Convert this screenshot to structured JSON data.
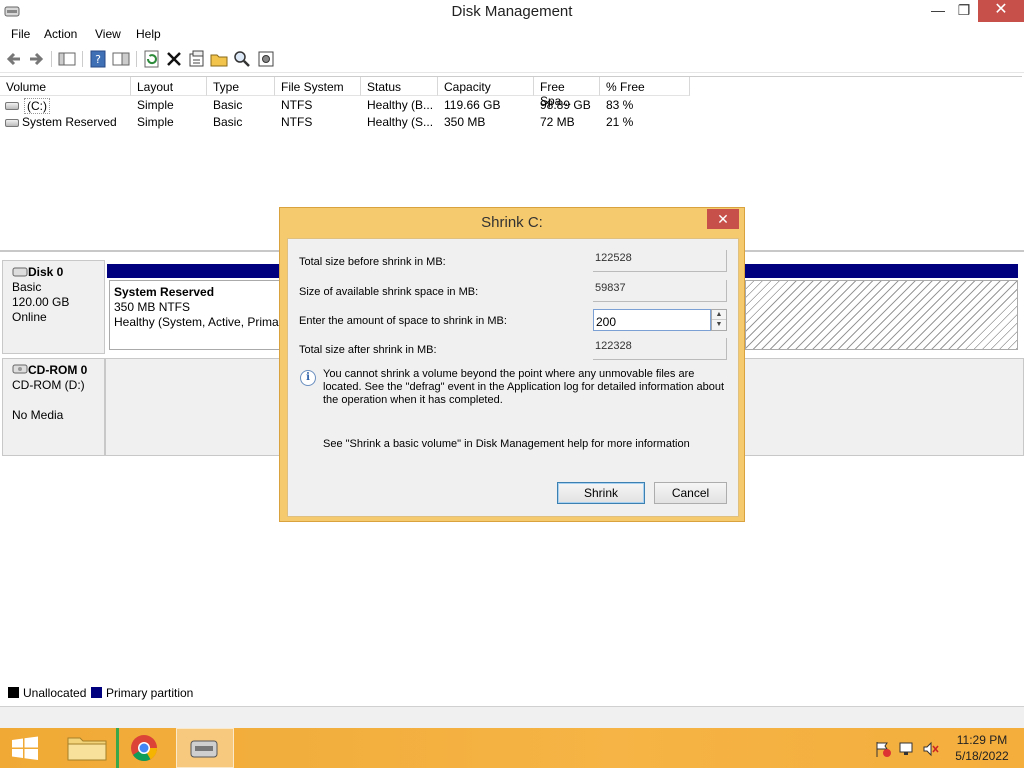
{
  "window": {
    "title": "Disk Management",
    "minimize": "—",
    "maximize": "❐",
    "close": "✕"
  },
  "menu": [
    "File",
    "Action",
    "View",
    "Help"
  ],
  "volume_table": {
    "columns": [
      "Volume",
      "Layout",
      "Type",
      "File System",
      "Status",
      "Capacity",
      "Free Spa...",
      "% Free"
    ],
    "rows": [
      [
        "(C:)",
        "Simple",
        "Basic",
        "NTFS",
        "Healthy (B...",
        "119.66 GB",
        "98.89 GB",
        "83 %"
      ],
      [
        "System Reserved",
        "Simple",
        "Basic",
        "NTFS",
        "Healthy (S...",
        "350 MB",
        "72 MB",
        "21 %"
      ]
    ]
  },
  "disks": {
    "disk0": {
      "name": "Disk 0",
      "type": "Basic",
      "size": "120.00 GB",
      "state": "Online"
    },
    "system_reserved": {
      "name": "System Reserved",
      "size": "350 MB NTFS",
      "status": "Healthy (System, Active, Primar"
    },
    "cdrom0": {
      "name": "CD-ROM 0",
      "drive": "CD-ROM (D:)",
      "media": "No Media"
    }
  },
  "legend": {
    "unallocated": "Unallocated",
    "unallocated_color": "#000000",
    "primary": "Primary partition",
    "primary_color": "#00007f"
  },
  "dialog": {
    "title": "Shrink C:",
    "close": "✕",
    "total_before_label": "Total size before shrink in MB:",
    "total_before_value": "122528",
    "available_label": "Size of available shrink space in MB:",
    "available_value": "59837",
    "amount_label": "Enter the amount of space to shrink in MB:",
    "amount_value": "200",
    "total_after_label": "Total size after shrink in MB:",
    "total_after_value": "122328",
    "note": "You cannot shrink a volume beyond the point where any unmovable files are located. See the \"defrag\" event in the Application log for detailed information about the operation when it has completed.",
    "help": "See \"Shrink a basic volume\" in Disk Management help for more information",
    "shrink_button": "Shrink",
    "cancel_button": "Cancel"
  },
  "taskbar": {
    "time": "11:29 PM",
    "date": "5/18/2022"
  }
}
